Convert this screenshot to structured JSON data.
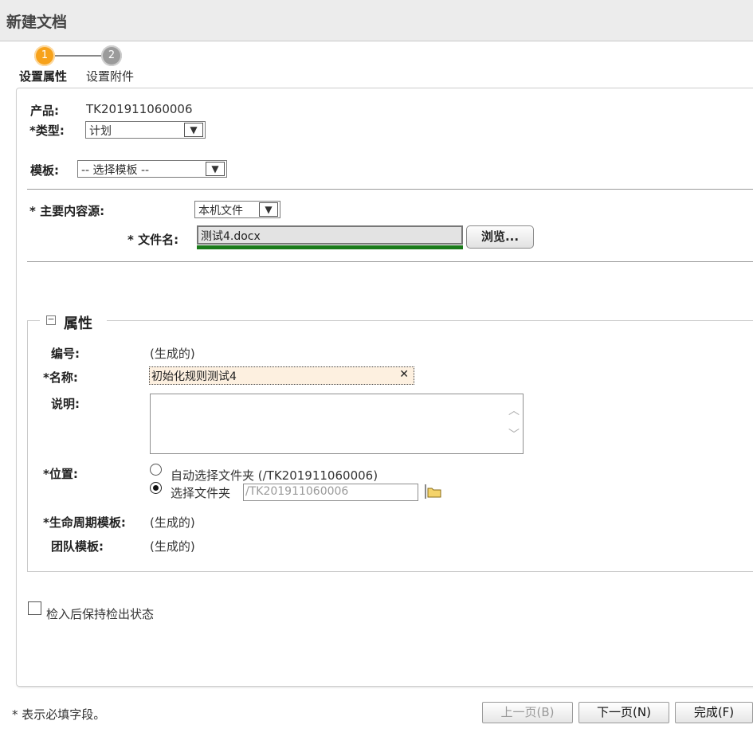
{
  "window": {
    "title": "新建文档"
  },
  "wizard": {
    "steps": [
      {
        "number": "1",
        "label": "设置属性"
      },
      {
        "number": "2",
        "label": "设置附件"
      }
    ]
  },
  "form": {
    "product_label": "产品:",
    "product_value": "TK201911060006",
    "type_label": "类型:",
    "type_value": "计划",
    "template_label": "模板:",
    "template_value": "-- 选择模板 --",
    "content_source_label": "主要内容源:",
    "content_source_value": "本机文件",
    "filename_label": "文件名:",
    "filename_value": "测试4.docx",
    "browse_label": "浏览...",
    "required_mark": "*"
  },
  "attributes": {
    "section_title": "属性",
    "number_label": "编号:",
    "number_value": "(生成的)",
    "name_label": "名称:",
    "name_value": "初始化规则测试4",
    "description_label": "说明:",
    "location_label": "位置:",
    "auto_folder_label": "自动选择文件夹 (/TK201911060006)",
    "select_folder_label": "选择文件夹",
    "folder_path": "/TK201911060006",
    "lifecycle_label": "生命周期模板:",
    "lifecycle_value": "(生成的)",
    "team_label": "团队模板:",
    "team_value": "(生成的)"
  },
  "checkin": {
    "label": "检入后保持检出状态"
  },
  "footer": {
    "required_note": "* 表示必填字段。",
    "prev_label": "上一页(B)",
    "next_label": "下一页(N)",
    "finish_label": "完成(F)"
  },
  "colors": {
    "step_active": "#f7a21b",
    "step_inactive": "#9b9b9b",
    "progress_green": "#1a7a1a",
    "name_field_bg": "#fdf0e0"
  }
}
